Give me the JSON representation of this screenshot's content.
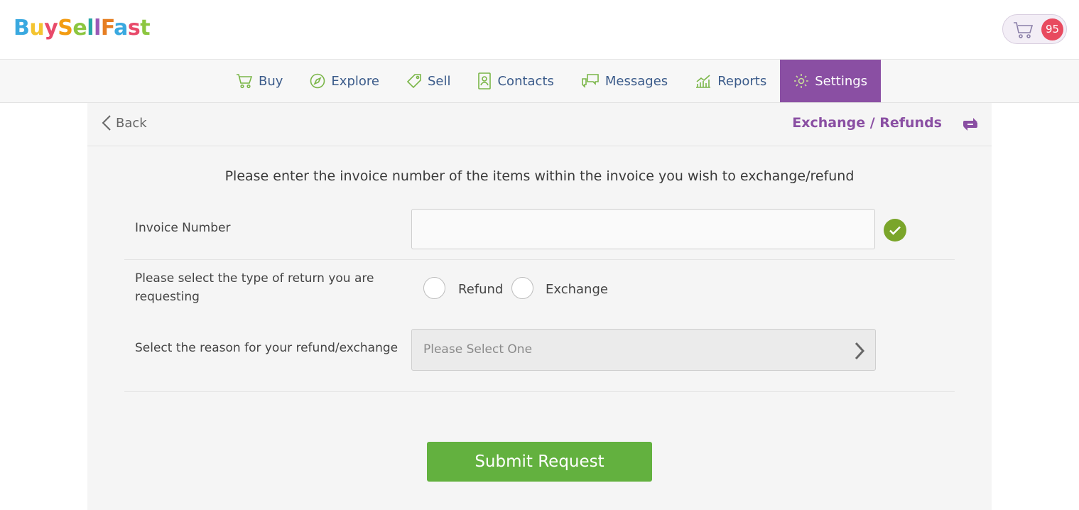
{
  "header": {
    "logo_parts": [
      "B",
      "u",
      "y",
      "S",
      "e",
      "l",
      "l",
      "F",
      "a",
      "s",
      "t"
    ],
    "cart_count": "95"
  },
  "nav": {
    "items": [
      {
        "label": "Buy",
        "icon": "cart-icon"
      },
      {
        "label": "Explore",
        "icon": "compass-icon"
      },
      {
        "label": "Sell",
        "icon": "tag-icon"
      },
      {
        "label": "Contacts",
        "icon": "address-book-icon"
      },
      {
        "label": "Messages",
        "icon": "chat-icon"
      },
      {
        "label": "Reports",
        "icon": "chart-icon"
      },
      {
        "label": "Settings",
        "icon": "gear-icon",
        "active": true
      }
    ]
  },
  "subbar": {
    "back_label": "Back",
    "title": "Exchange / Refunds"
  },
  "form": {
    "instruction": "Please enter the invoice number of the items within the invoice you wish to exchange/refund",
    "invoice_label": "Invoice Number",
    "invoice_value": "",
    "return_type_label_line1": "Please select the type of return you are",
    "return_type_label_line2": "requesting",
    "option_refund": "Refund",
    "option_exchange": "Exchange",
    "reason_label": "Select the reason for your refund/exchange",
    "reason_placeholder": "Please Select One",
    "submit_label": "Submit Request"
  },
  "colors": {
    "accent_purple": "#8a4fa3",
    "nav_text": "#3b5b8a",
    "submit_green": "#63b13f",
    "badge_red": "#e84a5f"
  }
}
